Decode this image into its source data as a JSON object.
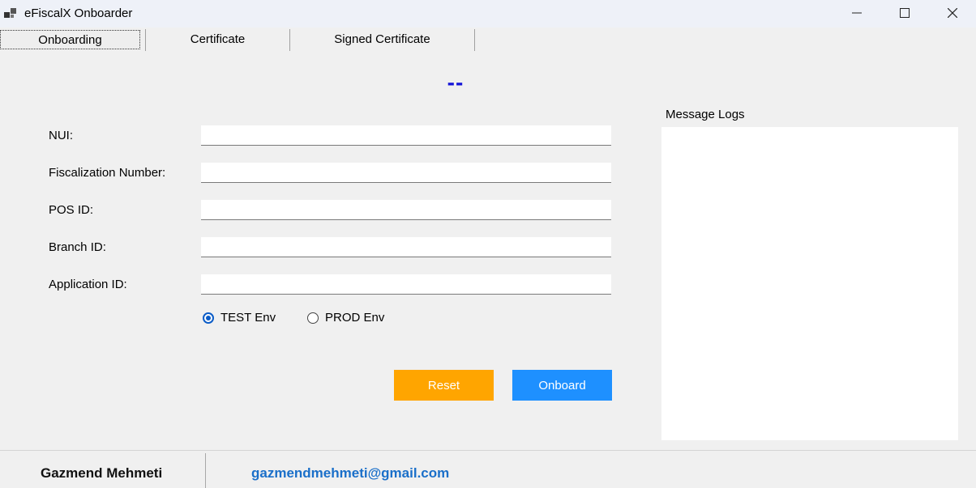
{
  "window": {
    "title": "eFiscalX Onboarder",
    "icon": "app-icon"
  },
  "tabs": [
    {
      "label": "Onboarding",
      "active": true
    },
    {
      "label": "Certificate",
      "active": false
    },
    {
      "label": "Signed Certificate",
      "active": false
    }
  ],
  "header": {
    "placeholder_title": "--",
    "color": "#1515d8"
  },
  "form": {
    "fields": [
      {
        "label": "NUI:",
        "value": ""
      },
      {
        "label": "Fiscalization Number:",
        "value": ""
      },
      {
        "label": "POS ID:",
        "value": ""
      },
      {
        "label": "Branch ID:",
        "value": ""
      },
      {
        "label": "Application ID:",
        "value": ""
      }
    ],
    "environment": {
      "options": [
        "TEST Env",
        "PROD Env"
      ],
      "selected": "TEST Env"
    },
    "reset_label": "Reset",
    "onboard_label": "Onboard",
    "reset_color": "#ffa500",
    "onboard_color": "#1e90ff"
  },
  "logs": {
    "label": "Message Logs",
    "content": ""
  },
  "footer": {
    "author": "Gazmend Mehmeti",
    "email": "gazmendmehmeti@gmail.com"
  }
}
